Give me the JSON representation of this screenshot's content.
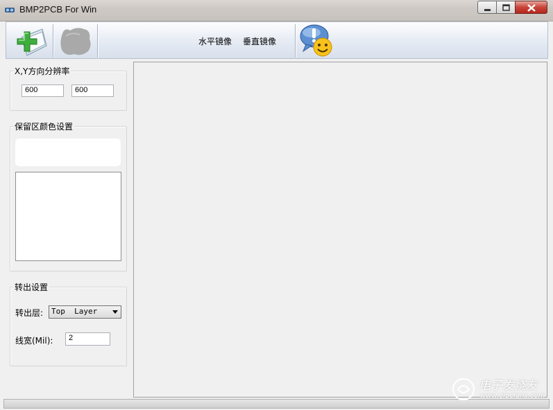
{
  "window": {
    "title": "BMP2PCB For Win"
  },
  "toolbar": {
    "mirror_horizontal": "水平镜像",
    "mirror_vertical": "垂直镜像",
    "icons": [
      "open-file-icon",
      "grayed-image-icon",
      "help-smiley-icon"
    ]
  },
  "resolution": {
    "label": "X,Y方向分辨率",
    "x_value": "600",
    "y_value": "600"
  },
  "reserve_color": {
    "label": "保留区颜色设置"
  },
  "output": {
    "label": "转出设置",
    "layer_label": "转出层:",
    "layer_value": "Top  Layer",
    "width_label": "线宽(Mil):",
    "width_value": "2"
  },
  "watermark": {
    "line1": "电子发烧友",
    "line2": "www.elecfans.com"
  },
  "colors": {
    "toolbar_bg": "#e7ecf4",
    "close_red": "#c7453a"
  }
}
